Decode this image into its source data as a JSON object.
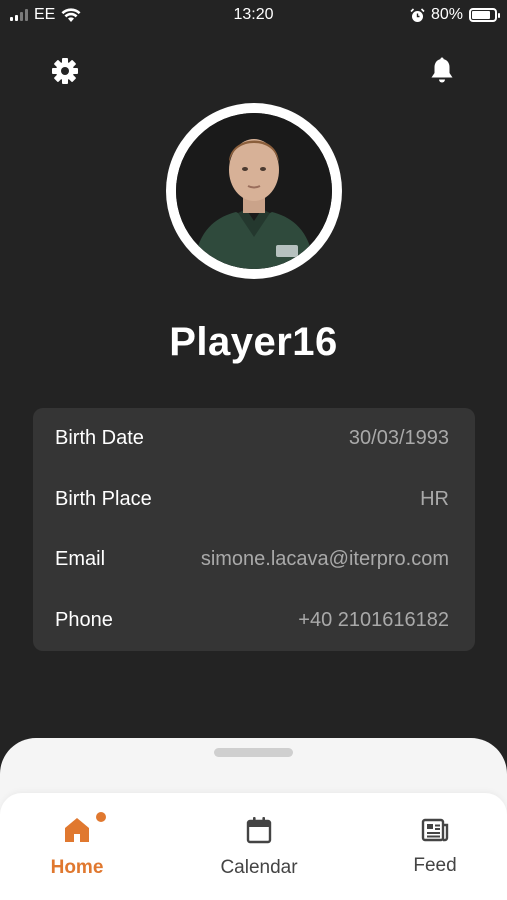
{
  "status_bar": {
    "carrier": "EE",
    "time": "13:20",
    "battery": "80%",
    "battery_level": 0.8
  },
  "header": {
    "settings_icon": "gear-icon",
    "notifications_icon": "bell-icon"
  },
  "profile": {
    "name": "Player16"
  },
  "details": [
    {
      "label": "Birth Date",
      "value": "30/03/1993"
    },
    {
      "label": "Birth Place",
      "value": "HR"
    },
    {
      "label": "Email",
      "value": "simone.lacava@iterpro.com"
    },
    {
      "label": "Phone",
      "value": "+40 2101616182"
    }
  ],
  "tabs": [
    {
      "label": "Home",
      "icon": "home-icon",
      "active": true,
      "badge": true
    },
    {
      "label": "Calendar",
      "icon": "calendar-icon",
      "active": false
    },
    {
      "label": "Feed",
      "icon": "feed-icon",
      "active": false
    }
  ],
  "colors": {
    "background": "#232323",
    "card": "#353535",
    "accent": "#e0782f"
  }
}
